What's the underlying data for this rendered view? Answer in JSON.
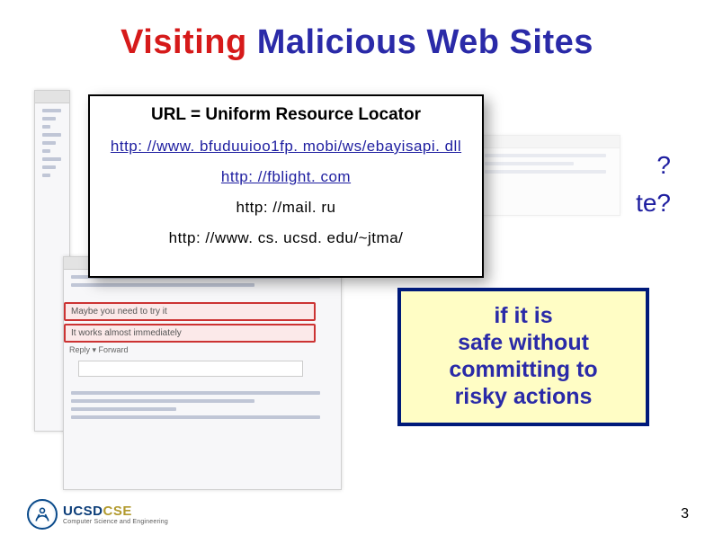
{
  "title": {
    "w1": "Visiting",
    "w2": "Malicious",
    "w3": "Web",
    "w4": "Sites"
  },
  "side": {
    "q1": "?",
    "q2": "te?"
  },
  "urlbox": {
    "heading": "URL = Uniform Resource Locator",
    "u1": "http: //www. bfuduuioo1fp. mobi/ws/ebayisapi. dll",
    "u2": "http: //fblight. com",
    "u3": "http: //mail. ru",
    "u4": "http: //www. cs. ucsd. edu/~jtma/"
  },
  "gmail": {
    "line1": "Maybe you need to try it",
    "line2": "It works almost immediately",
    "reply": "Reply ▾   Forward"
  },
  "goal": {
    "l1": "if it is",
    "l2": "safe without",
    "l3": "committing to",
    "l4": "risky actions"
  },
  "logo": {
    "brand1": "UCSD",
    "brand2": "CSE",
    "sub": "Computer Science and Engineering"
  },
  "page": "3"
}
